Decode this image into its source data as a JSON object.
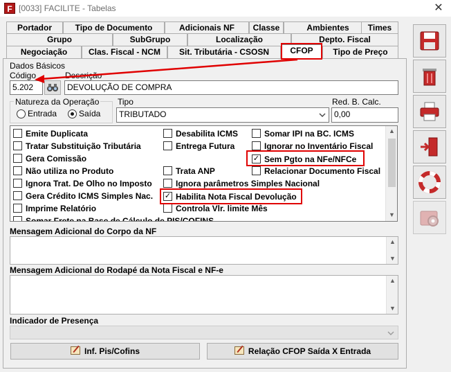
{
  "window": {
    "title": "[0033] FACILITE - Tabelas",
    "icon_letter": "F",
    "close_glyph": "✕"
  },
  "tabs": {
    "row1": [
      "Portador",
      "Tipo de Documento",
      "Adicionais NF",
      "Classe",
      "Ambientes",
      "Times"
    ],
    "row2": [
      "Grupo",
      "SubGrupo",
      "Localização",
      "Depto. Fiscal"
    ],
    "row3": [
      "Negociação",
      "Clas. Fiscal - NCM",
      "Sit. Tributária - CSOSN",
      "CFOP",
      "Tipo de Preço"
    ],
    "active": "CFOP"
  },
  "dados_basicos": {
    "section_label": "Dados Básicos",
    "codigo_label": "Código",
    "codigo_value": "5.202",
    "descricao_label": "Descrição",
    "descricao_value": "DEVOLUÇÃO DE COMPRA"
  },
  "natureza": {
    "label": "Natureza da Operação",
    "options": [
      {
        "label": "Entrada",
        "checked": false
      },
      {
        "label": "Saída",
        "checked": true
      }
    ]
  },
  "tipo": {
    "label": "Tipo",
    "value": "TRIBUTADO"
  },
  "red_calc": {
    "label": "Red. B. Calc.",
    "value": "0,00"
  },
  "options": {
    "col1": [
      {
        "label": "Emite Duplicata",
        "checked": false
      },
      {
        "label": "Tratar Substituição Tributária",
        "checked": false
      },
      {
        "label": "Gera Comissão",
        "checked": false
      },
      {
        "label": "Não utiliza no Produto",
        "checked": false
      },
      {
        "label": "Ignora Trat. De Olho no Imposto",
        "checked": false
      },
      {
        "label": "Gera Crédito ICMS Simples Nac.",
        "checked": false
      },
      {
        "label": "Imprime Relatório",
        "checked": false
      },
      {
        "label": "Somar Frete na Base de Cálculo de PIS/COFINS",
        "checked": false
      }
    ],
    "col2": [
      {
        "label": "Desabilita ICMS",
        "checked": false
      },
      {
        "label": "Entrega Futura",
        "checked": false
      },
      {
        "label": "Trata ANP",
        "checked": false
      },
      {
        "label": "Ignora parâmetros Simples Nacional",
        "checked": false
      },
      {
        "label": "Habilita Nota Fiscal Devolução",
        "checked": true
      },
      {
        "label": "Controla Vlr. limite Mês",
        "checked": false
      }
    ],
    "col3": [
      {
        "label": "Somar IPI na BC. ICMS",
        "checked": false
      },
      {
        "label": "Ignorar no Inventário Fiscal",
        "checked": false
      },
      {
        "label": "Sem Pgto na NFe/NFCe",
        "checked": true
      },
      {
        "label": "Relacionar Documento Fiscal",
        "checked": false
      }
    ]
  },
  "mensagem_corpo_label": "Mensagem Adicional do Corpo da NF",
  "mensagem_rodape_label": "Mensagem Adicional do Rodapé da Nota Fiscal e NF-e",
  "indicador_presenca_label": "Indicador de Presença",
  "buttons": {
    "pis_cofins": "Inf. Pis/Cofins",
    "relacao_cfop": "Relação CFOP Saída X Entrada"
  },
  "check_glyph": "✓",
  "icons": {
    "side": [
      "save-icon",
      "trash-icon",
      "print-icon",
      "exit-icon",
      "help-icon",
      "settings-icon"
    ],
    "lookup": "binoculars-icon"
  },
  "colors": {
    "highlight": "#e00000",
    "side_icon": "#c42a2a"
  }
}
